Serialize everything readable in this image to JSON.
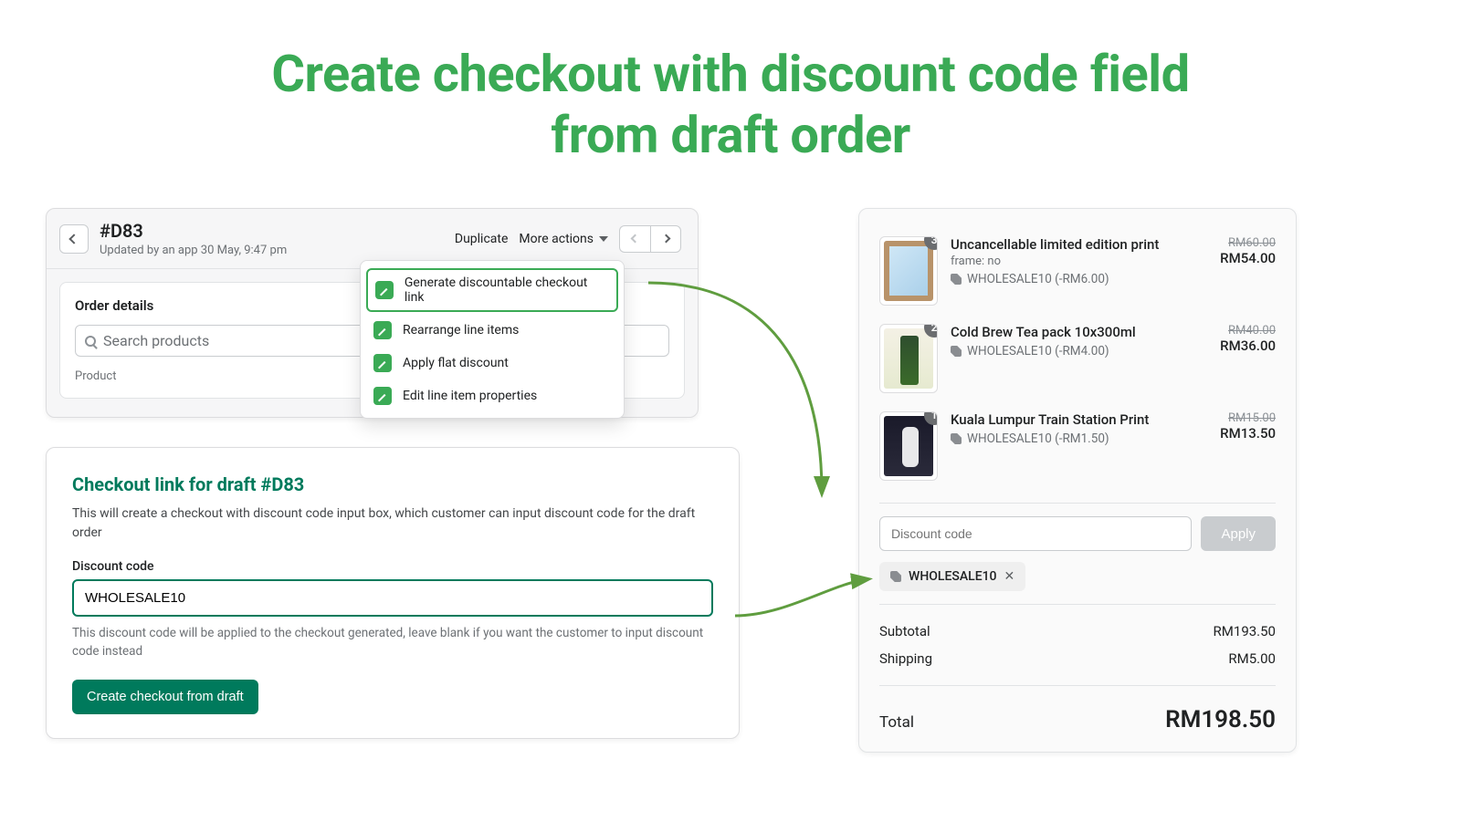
{
  "hero": {
    "line1": "Create checkout with discount code field",
    "line2": "from draft order"
  },
  "order": {
    "id": "#D83",
    "updated": "Updated by an app 30 May, 9:47 pm",
    "duplicate": "Duplicate",
    "more_actions": "More actions",
    "details_header": "Order details",
    "search_placeholder": "Search products",
    "product_label": "Product",
    "menu": [
      "Generate discountable checkout link",
      "Rearrange line items",
      "Apply flat discount",
      "Edit line item properties"
    ]
  },
  "checkout_form": {
    "title": "Checkout link for draft #D83",
    "desc": "This will create a checkout with discount code input box, which customer can input discount code for the draft order",
    "label": "Discount code",
    "value": "WHOLESALE10",
    "help": "This discount code will be applied to the checkout generated, leave blank if you want the customer to input discount code instead",
    "button": "Create checkout from draft"
  },
  "summary": {
    "items": [
      {
        "qty": "3",
        "title": "Uncancellable limited edition print",
        "variant": "frame: no",
        "discount": "WHOLESALE10 (-RM6.00)",
        "old": "RM60.00",
        "new": "RM54.00"
      },
      {
        "qty": "2",
        "title": "Cold Brew Tea pack 10x300ml",
        "variant": "",
        "discount": "WHOLESALE10 (-RM4.00)",
        "old": "RM40.00",
        "new": "RM36.00"
      },
      {
        "qty": "1",
        "title": "Kuala Lumpur Train Station Print",
        "variant": "",
        "discount": "WHOLESALE10 (-RM1.50)",
        "old": "RM15.00",
        "new": "RM13.50"
      }
    ],
    "discount_placeholder": "Discount code",
    "apply": "Apply",
    "chip": "WHOLESALE10",
    "subtotal_label": "Subtotal",
    "subtotal_value": "RM193.50",
    "shipping_label": "Shipping",
    "shipping_value": "RM5.00",
    "total_label": "Total",
    "total_value": "RM198.50"
  }
}
